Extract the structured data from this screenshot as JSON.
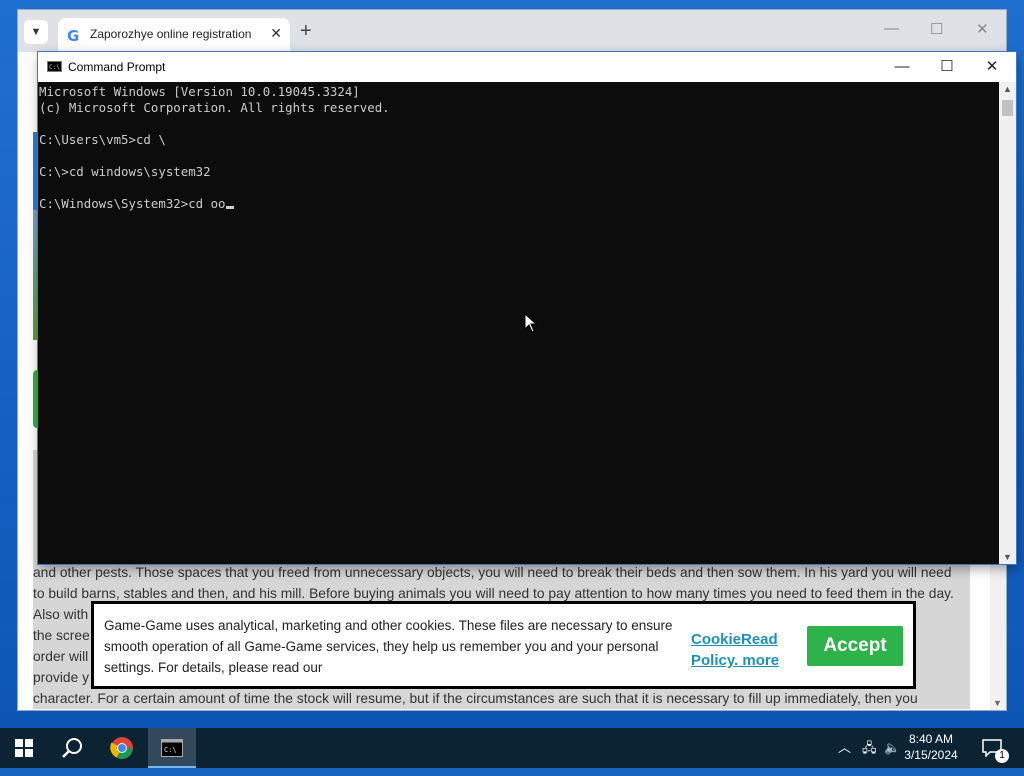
{
  "browser": {
    "tab_title": "Zaporozhye online registration",
    "tab_favicon": "G",
    "tab_menu_icon": "chevron-down-icon",
    "new_tab_symbol": "+",
    "close_symbol": "✕",
    "minimize_symbol": "—",
    "maximize_symbol": "☐"
  },
  "article_lines": [
    "and other pests. Those spaces that you freed from unnecessary objects, you will need to break their beds and then sow them. In his yard you will need",
    "to build barns, stables and then, and his mill. Before buying animals you will need to pay attention to how many times you need to feed them in the day.",
    "Also with",
    "the scree",
    "order will",
    "provide y",
    "character. For a certain amount of time the stock will resume, but if the circumstances are such that it is necessary to fill up immediately, then you"
  ],
  "cmd": {
    "title": "Command Prompt",
    "lines": [
      "Microsoft Windows [Version 10.0.19045.3324]",
      "(c) Microsoft Corporation. All rights reserved.",
      "",
      "C:\\Users\\vm5>cd \\",
      "",
      "C:\\>cd windows\\system32",
      "",
      "C:\\Windows\\System32>cd oo"
    ]
  },
  "cookie": {
    "text": "Game-Game uses analytical, marketing and other cookies. These files are necessary to ensure smooth operation of all Game-Game services, they help us remember you and your personal settings. For details, please read our",
    "link_text": "CookieRead Policy. more",
    "accept_label": "Accept"
  },
  "taskbar": {
    "time": "8:40 AM",
    "date": "3/15/2024",
    "notification_count": "1",
    "icons": [
      "windows-start-icon",
      "search-icon",
      "chrome-icon",
      "cmd-icon"
    ]
  },
  "colors": {
    "accept_green": "#2db34a",
    "link_blue": "#1e90b8",
    "console_bg": "#0c0c0c",
    "console_fg": "#cccccc"
  }
}
